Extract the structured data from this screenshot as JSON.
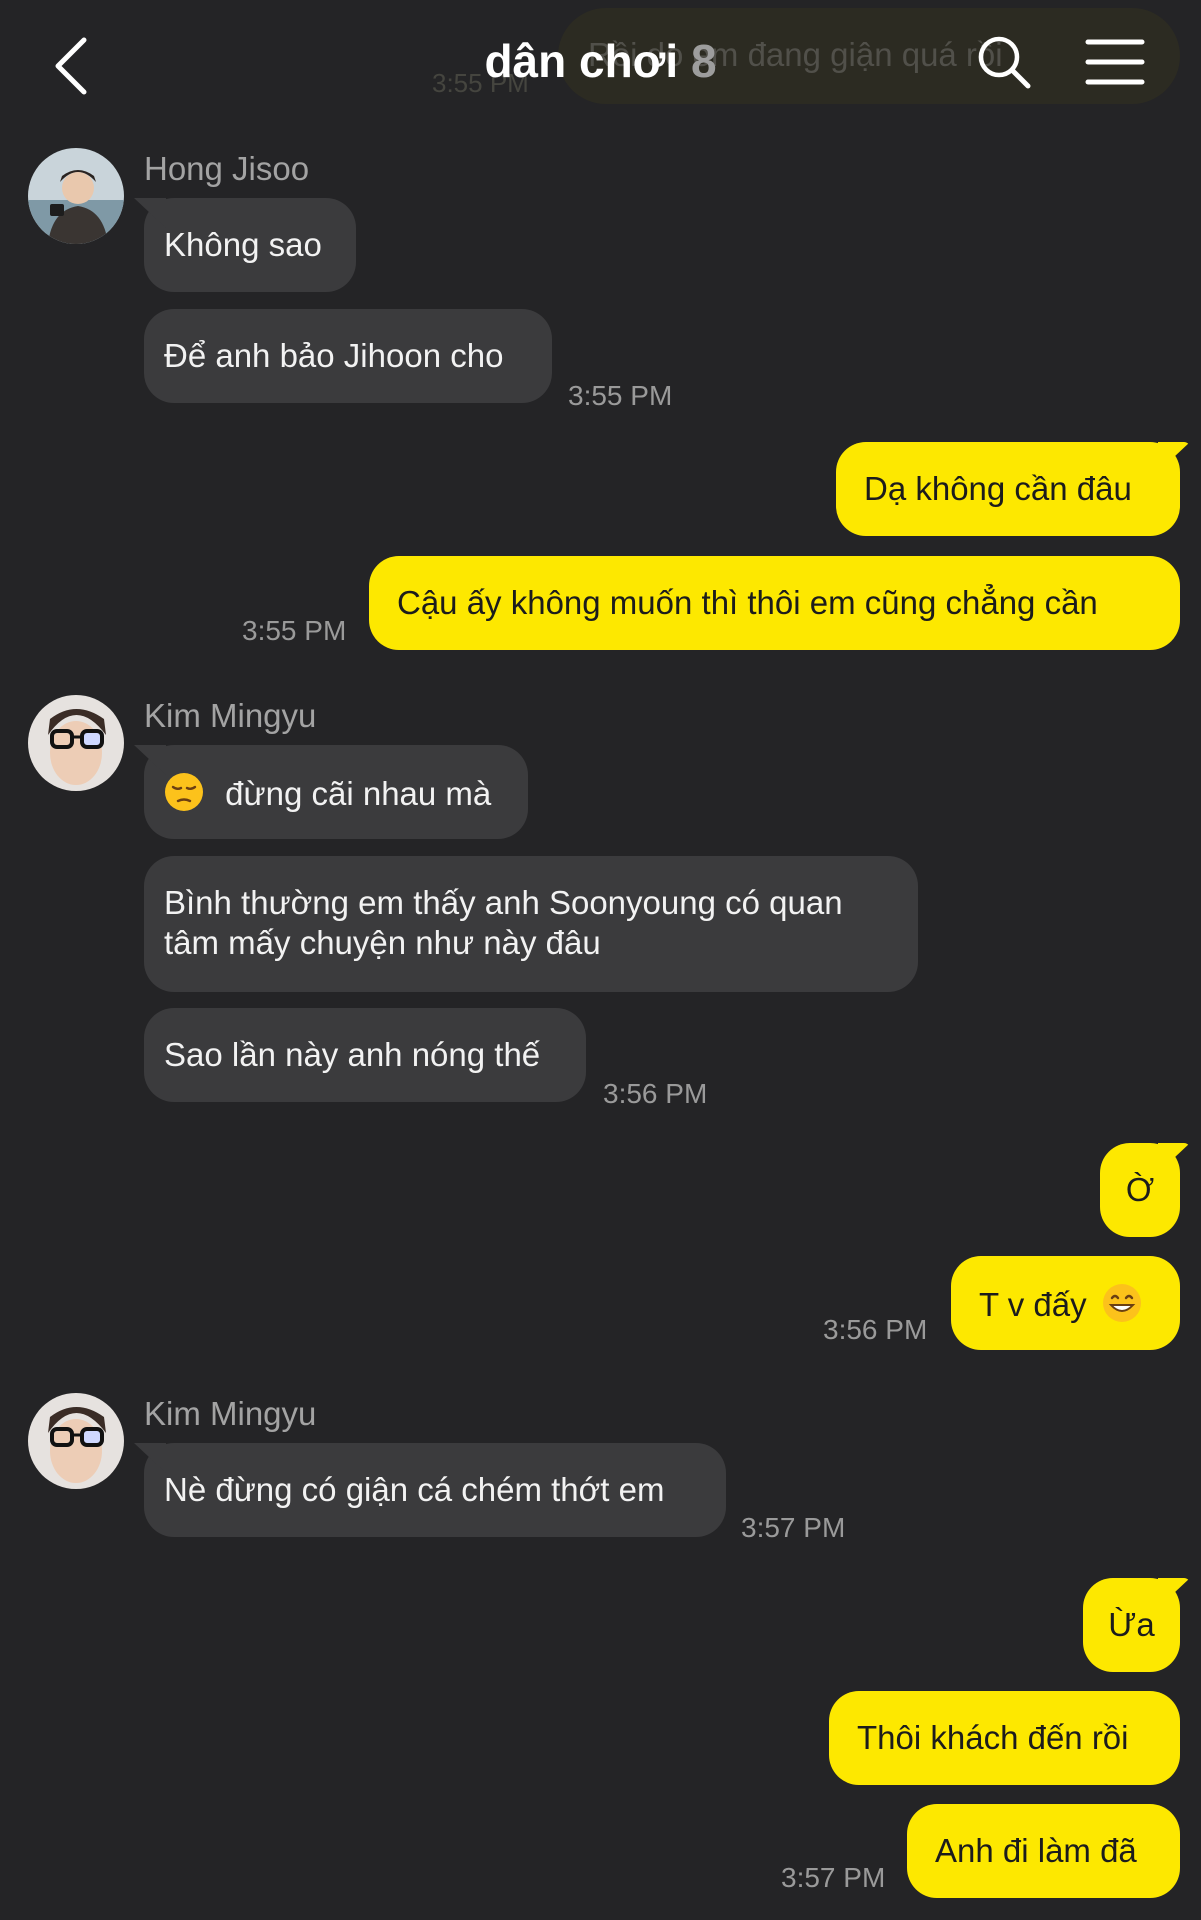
{
  "header": {
    "title": "dân chơi",
    "member_count": "8",
    "ghost_preview_text": "Rồi do em đang giận quá rồi",
    "ghost_preview_time": "3:55 PM",
    "icons": {
      "back": "chevron-left-icon",
      "search": "search-icon",
      "menu": "hamburger-menu-icon"
    }
  },
  "messages": {
    "group1": {
      "sender": "Hong Jisoo",
      "m1": "Không sao",
      "m2": "Để anh bảo Jihoon cho",
      "time": "3:55 PM"
    },
    "group2": {
      "m1": "Dạ không cần đâu",
      "m2": "Cậu ấy không muốn thì thôi em cũng chẳng cần",
      "time": "3:55 PM"
    },
    "group3": {
      "sender": "Kim Mingyu",
      "m1_emoji": "pensive-face-emoji",
      "m1": "đừng cãi nhau mà",
      "m2_line1": "Bình thường em thấy anh Soonyoung có quan",
      "m2_line2": "tâm mấy chuyện như này đâu",
      "m3": "Sao lần này anh nóng thế",
      "time": "3:56 PM"
    },
    "group4": {
      "m1": "Ờ",
      "m2": "T v đấy",
      "m2_emoji": "grinning-face-emoji",
      "time": "3:56 PM"
    },
    "group5": {
      "sender": "Kim Mingyu",
      "m1": "Nè đừng có giận cá chém thớt em",
      "time": "3:57 PM"
    },
    "group6": {
      "m1": "Ừa",
      "m2": "Thôi khách đến rồi",
      "m3": "Anh đi làm đã",
      "time": "3:57 PM"
    }
  },
  "colors": {
    "background": "#242426",
    "incoming_bubble": "#3b3b3d",
    "outgoing_bubble": "#fde800",
    "timestamp": "#9a9a9a"
  }
}
